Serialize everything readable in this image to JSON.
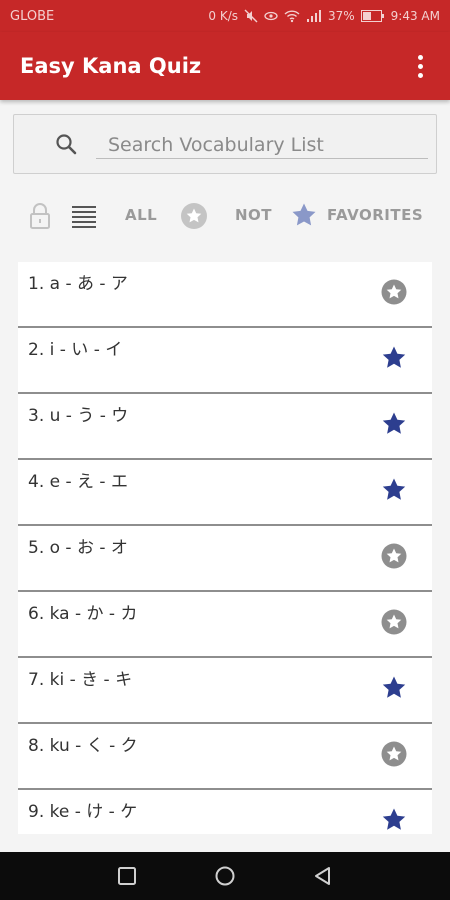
{
  "status_bar": {
    "carrier": "GLOBE",
    "speed": "0 K/s",
    "battery": "37%",
    "time": "9:43 AM"
  },
  "app_bar": {
    "title": "Easy Kana Quiz",
    "menu_icon": "more-vert-icon"
  },
  "search": {
    "placeholder": "Search Vocabulary List",
    "value": "",
    "icon": "search-icon"
  },
  "filters": {
    "lock_icon": "lock-icon",
    "list_icon": "list-view-icon",
    "all_label": "ALL",
    "not_label": "NOT",
    "favorites_label": "FAVORITES"
  },
  "colors": {
    "primary": "#c62828",
    "star_active": "#2d3e8f",
    "star_inactive": "#8e8e8e"
  },
  "vocabulary": [
    {
      "text": "1. a - あ - ア",
      "favorite": false
    },
    {
      "text": "2. i - い - イ",
      "favorite": true
    },
    {
      "text": "3. u - う - ウ",
      "favorite": true
    },
    {
      "text": "4. e - え - エ",
      "favorite": true
    },
    {
      "text": "5. o - お - オ",
      "favorite": false
    },
    {
      "text": "6. ka - か - カ",
      "favorite": false
    },
    {
      "text": "7. ki - き - キ",
      "favorite": true
    },
    {
      "text": "8. ku - く - ク",
      "favorite": false
    },
    {
      "text": "9. ke - け - ケ",
      "favorite": true
    }
  ],
  "nav_bar": {
    "recents_icon": "square-icon",
    "home_icon": "circle-icon",
    "back_icon": "triangle-back-icon"
  }
}
